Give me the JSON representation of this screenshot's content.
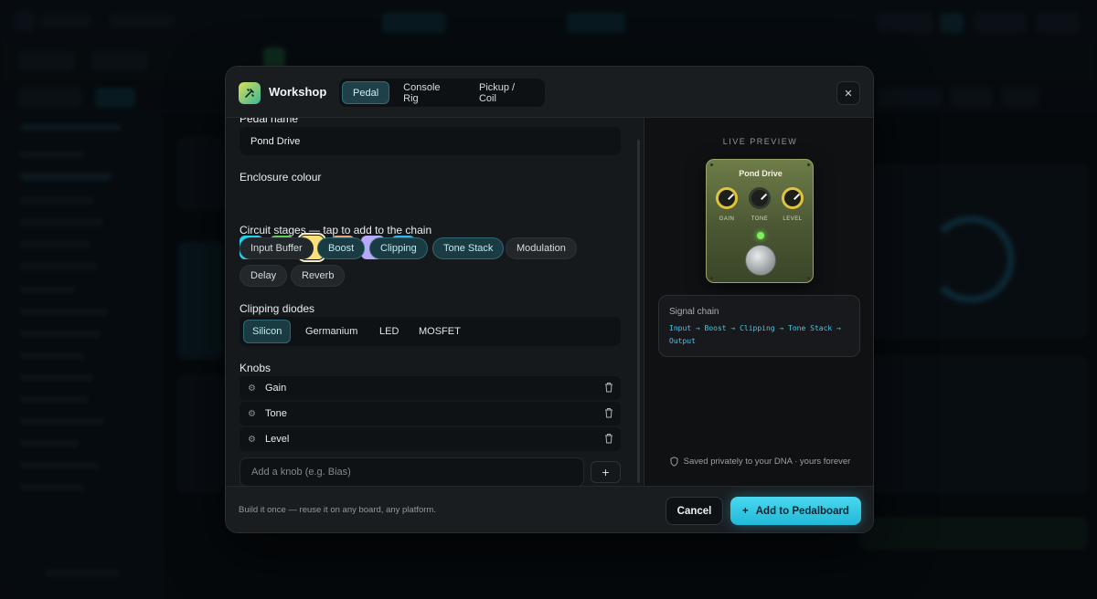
{
  "modal": {
    "title": "Workshop",
    "tabs": [
      {
        "label": "Pedal",
        "active": true
      },
      {
        "label": "Console Rig",
        "active": false
      },
      {
        "label": "Pickup / Coil",
        "active": false
      }
    ],
    "close_icon": "close-icon"
  },
  "form": {
    "name_label": "Pedal name",
    "name_value": "Pond Drive",
    "colour_label": "Enclosure colour",
    "colours": [
      "#22d3ee",
      "#5fce55",
      "#fbe07a",
      "#f0a07a",
      "#b8a8f8",
      "#38b2ef"
    ],
    "selected_colour": "#fbe07a",
    "stages_label": "Circuit stages — tap to add to the chain",
    "stages": [
      {
        "label": "Input Buffer",
        "on": false
      },
      {
        "label": "Boost",
        "on": true
      },
      {
        "label": "Clipping",
        "on": true
      },
      {
        "label": "Tone Stack",
        "on": true
      },
      {
        "label": "Modulation",
        "on": false
      },
      {
        "label": "Delay",
        "on": false
      },
      {
        "label": "Reverb",
        "on": false
      }
    ],
    "diodes_label": "Clipping diodes",
    "diodes": [
      {
        "label": "Silicon",
        "on": true
      },
      {
        "label": "Germanium",
        "on": false
      },
      {
        "label": "LED",
        "on": false
      },
      {
        "label": "MOSFET",
        "on": false
      }
    ],
    "knobs_label": "Knobs",
    "knobs": [
      "Gain",
      "Tone",
      "Level"
    ],
    "add_knob_placeholder": "Add a knob (e.g. Bias)",
    "add_button": "+"
  },
  "preview": {
    "title": "LIVE PREVIEW",
    "pedal_name": "Pond Drive",
    "knob_labels": [
      "GAIN",
      "TONE",
      "LEVEL"
    ],
    "chain_heading": "Signal chain",
    "chain_value": "Input → Boost → Clipping → Tone Stack → Output",
    "saved_note": "Saved privately to your DNA · yours forever"
  },
  "footer": {
    "note": "Build it once — reuse it on any board, any platform.",
    "cancel_label": "Cancel",
    "primary_label": "Add to Pedalboard"
  }
}
